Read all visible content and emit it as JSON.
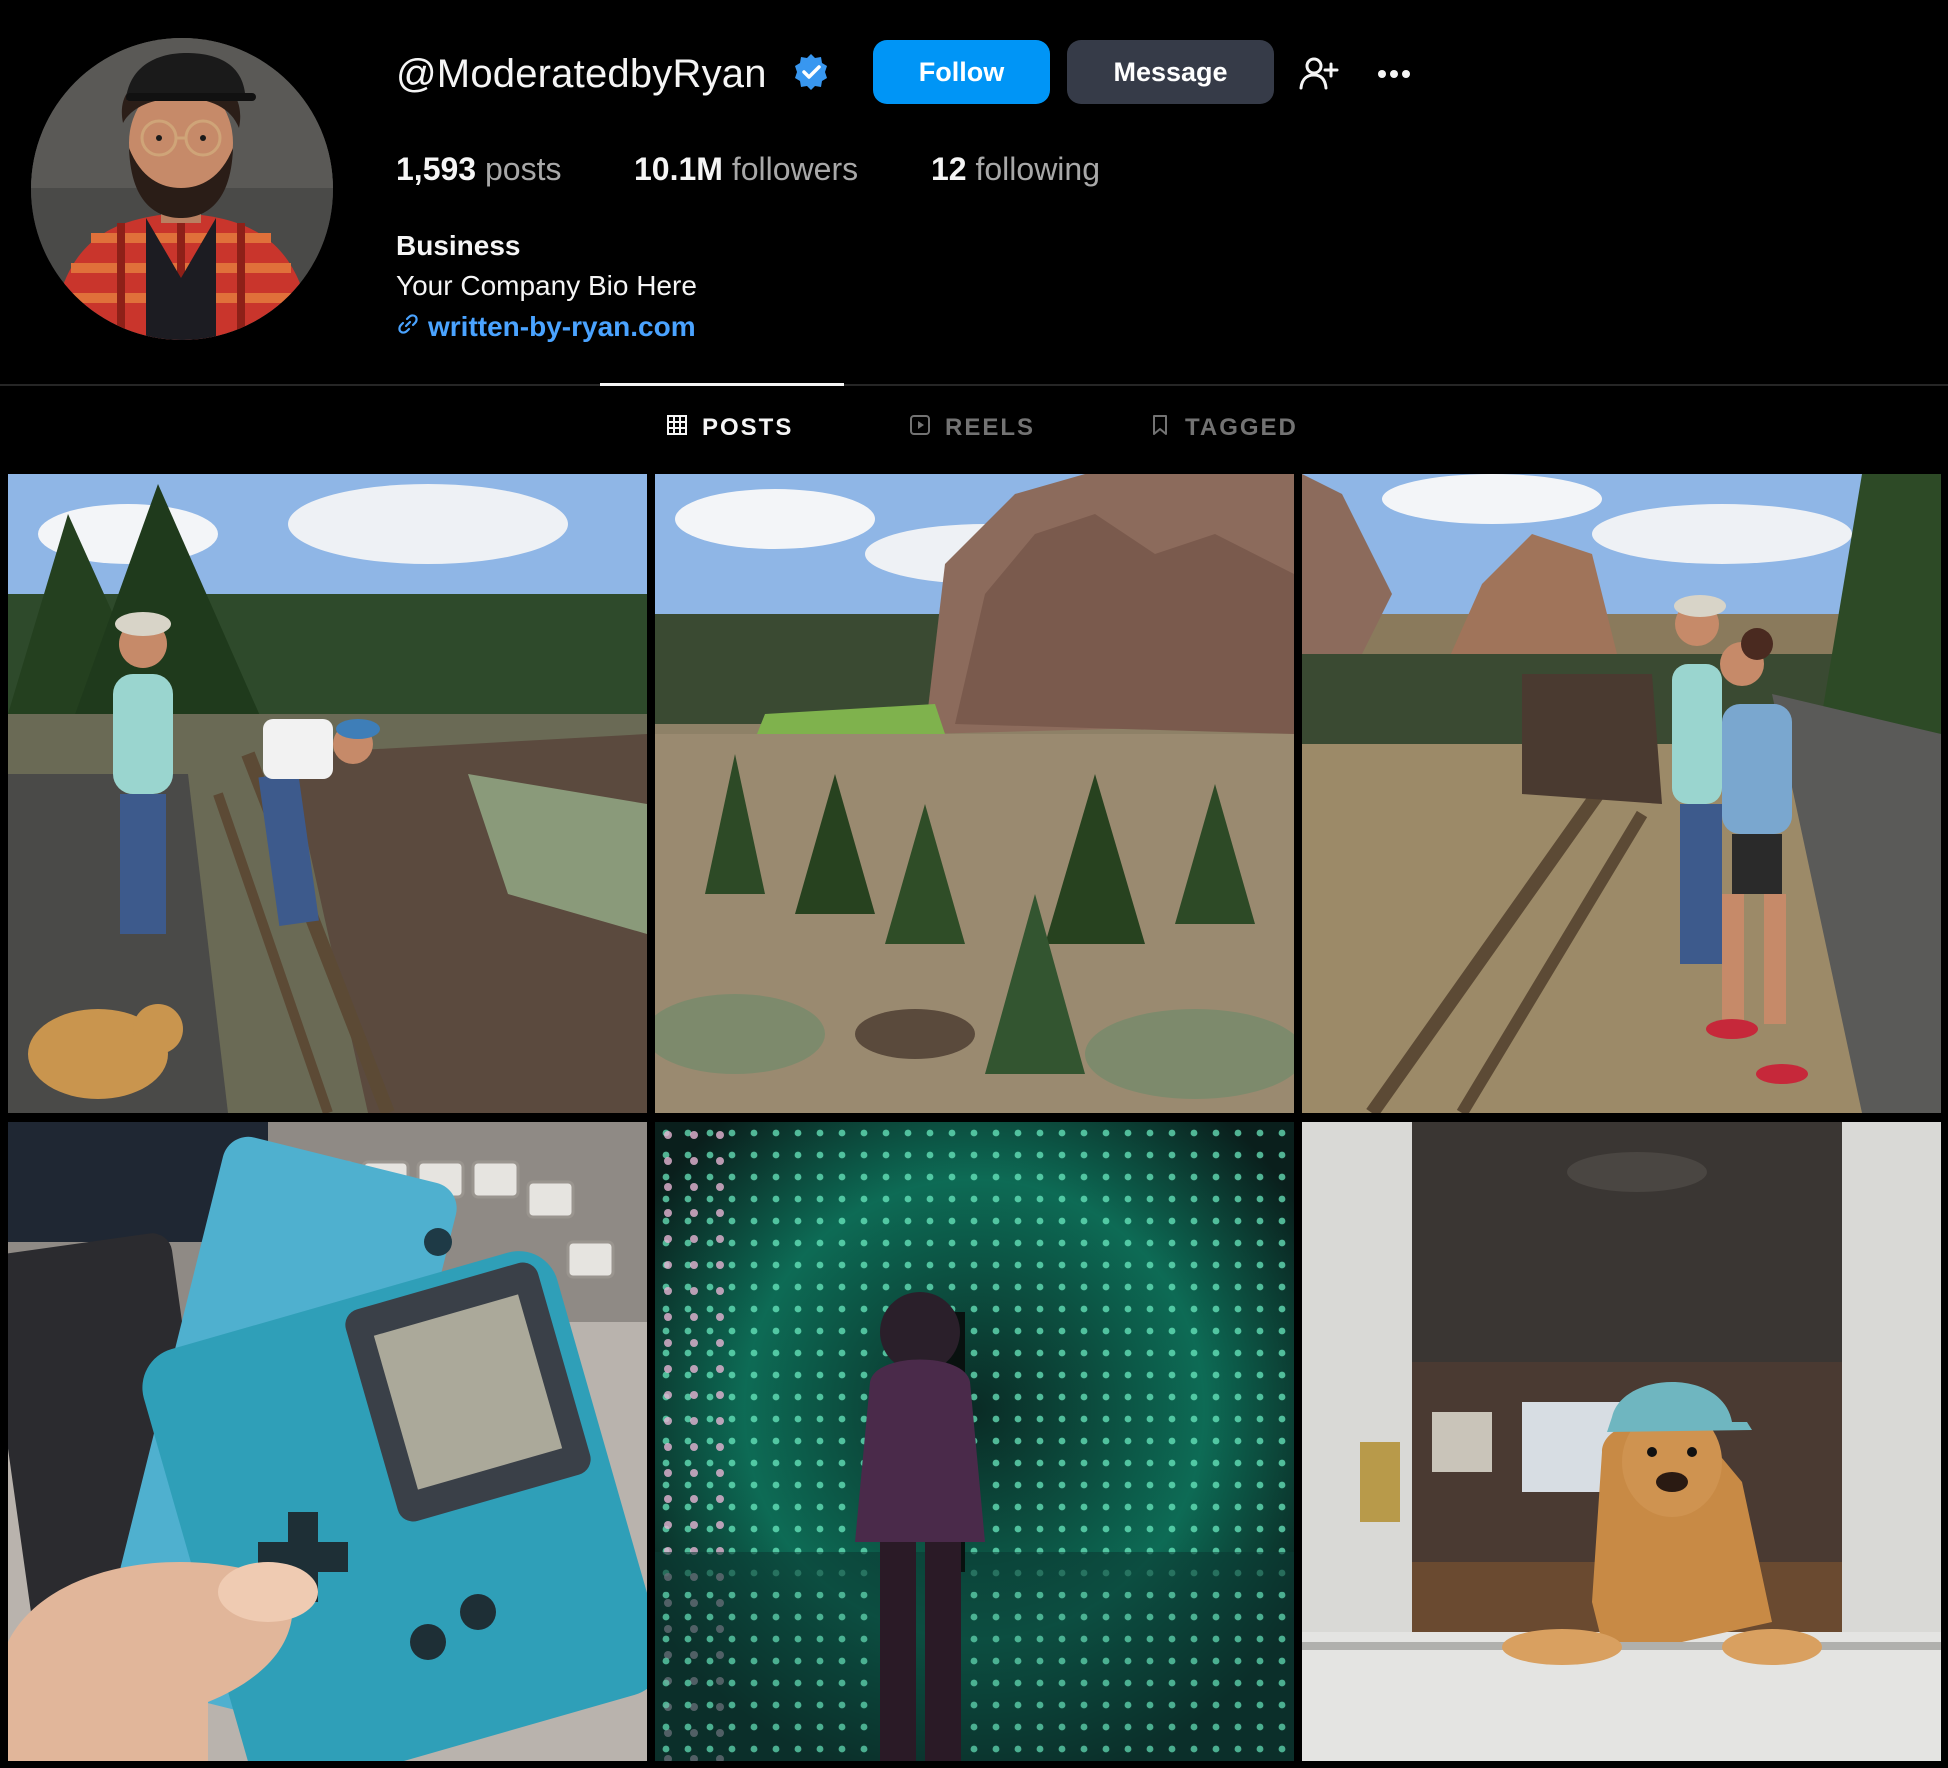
{
  "profile": {
    "username": "@ModeratedbyRyan",
    "verified_icon": "verified-badge-icon",
    "follow_label": "Follow",
    "message_label": "Message",
    "stats": {
      "posts_count": "1,593",
      "posts_label": "posts",
      "followers_count": "10.1M",
      "followers_label": "followers",
      "following_count": "12",
      "following_label": "following"
    },
    "category": "Business",
    "bio": "Your Company Bio Here",
    "link": "written-by-ryan.com"
  },
  "tabs": [
    {
      "label": "POSTS",
      "icon": "grid-icon",
      "active": true
    },
    {
      "label": "REELS",
      "icon": "reels-icon",
      "active": false
    },
    {
      "label": "TAGGED",
      "icon": "tagged-icon",
      "active": false
    }
  ],
  "colors": {
    "background": "#000000",
    "accent": "#0095f6",
    "link": "#4aa3ff",
    "secondary_text": "#a8a8a8"
  }
}
